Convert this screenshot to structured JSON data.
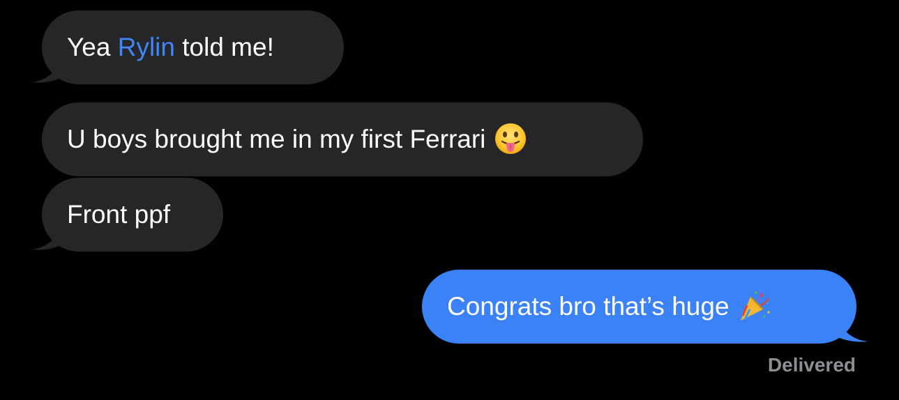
{
  "conversation": {
    "messages": [
      {
        "direction": "incoming",
        "text_before": "Yea ",
        "mention": "Rylin",
        "text_after": " told me!"
      },
      {
        "direction": "incoming",
        "text": "U boys brought me in my first Ferrari ",
        "emoji": "face-with-tongue-icon"
      },
      {
        "direction": "incoming",
        "text": "Front ppf"
      },
      {
        "direction": "outgoing",
        "text": "Congrats bro that’s huge ",
        "emoji": "party-popper-icon"
      }
    ],
    "delivery_status": "Delivered"
  },
  "colors": {
    "background": "#000000",
    "incoming_bubble": "#262629",
    "outgoing_bubble": "#3b82f6",
    "mention": "#3f86f6",
    "receipt_text": "#8e8e93",
    "message_text": "#ffffff"
  }
}
